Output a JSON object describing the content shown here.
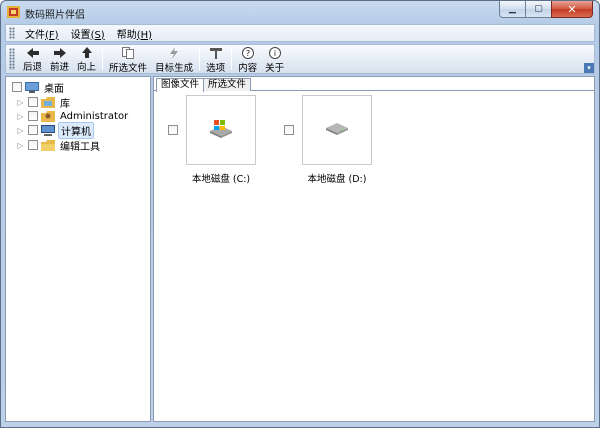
{
  "window": {
    "title": "数码照片伴侣"
  },
  "menu": [
    {
      "label": "文件",
      "key": "(F)"
    },
    {
      "label": "设置",
      "key": "(S)"
    },
    {
      "label": "帮助",
      "key": "(H)"
    }
  ],
  "toolbar": {
    "back": "后退",
    "forward": "前进",
    "up": "向上",
    "selected_files": "所选文件",
    "target_gen": "目标生成",
    "options": "选项",
    "contents": "内容",
    "about": "关于"
  },
  "tree": {
    "root": "桌面",
    "items": [
      "库",
      "Administrator",
      "计算机",
      "编辑工具"
    ]
  },
  "tabs": [
    "图像文件",
    "所选文件"
  ],
  "drives": [
    {
      "label": "本地磁盘 (C:)"
    },
    {
      "label": "本地磁盘 (D:)"
    }
  ],
  "colors": {
    "accent": "#3a6ea5",
    "selection": "#dcebfc",
    "folder": "#e8b84a"
  }
}
